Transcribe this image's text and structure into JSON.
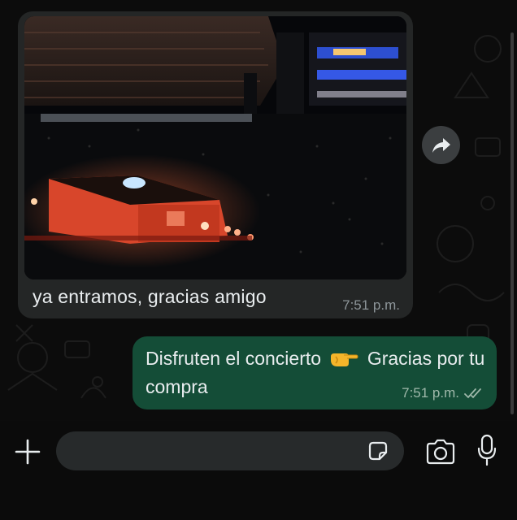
{
  "messages": {
    "incoming": {
      "text": "ya entramos, gracias amigo",
      "time": "7:51 p.m."
    },
    "outgoing": {
      "text_before_emoji": "Disfruten el concierto",
      "emoji": "pointing-hand-emoji",
      "text_after_emoji": "Gracias por tu compra",
      "time": "7:51 p.m.",
      "status": "read-double-check"
    }
  },
  "composer": {
    "placeholder": ""
  },
  "colors": {
    "incoming_bubble": "#242626",
    "outgoing_bubble": "#144d37",
    "chat_background": "#0c0c0c",
    "read_check": "#9fb8aa"
  },
  "icons": [
    "forward-icon",
    "plus-icon",
    "sticker-icon",
    "camera-icon",
    "microphone-icon",
    "double-check-icon"
  ]
}
